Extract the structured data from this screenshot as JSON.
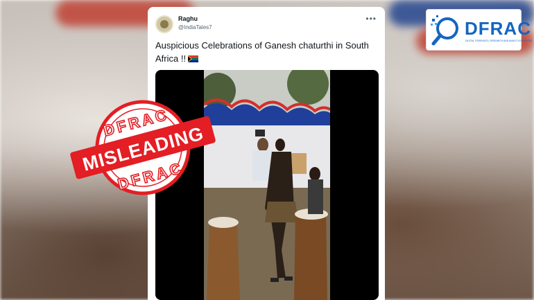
{
  "tweet": {
    "display_name": "Raghu",
    "handle": "@IndiaTales7",
    "text": "Auspicious Celebrations of Ganesh chaturthi in South Africa !!",
    "more_icon": "more-icon"
  },
  "stamp": {
    "label": "MISLEADING",
    "brand_top": "DFRAC",
    "brand_bottom": "DFRAC",
    "color": "#e31e24"
  },
  "logo": {
    "text": "DFRAC",
    "subtitle": "DIGITAL FORENSICS, RESEARCH AND ANALYTICS CENTRE",
    "color": "#1565c0"
  }
}
